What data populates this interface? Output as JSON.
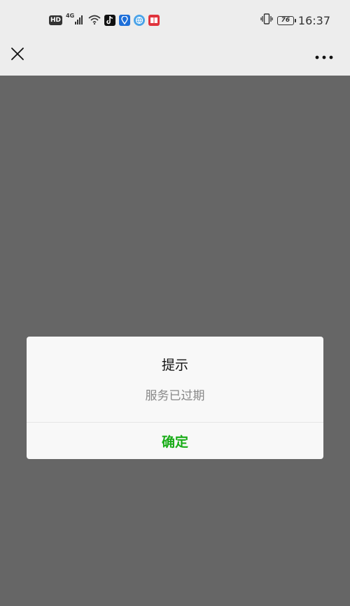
{
  "status_bar": {
    "hd_label": "HD",
    "network_type": "4G",
    "battery_level": "76",
    "time": "16:37",
    "icons": [
      "hd-badge",
      "signal-icon",
      "wifi-icon",
      "tiktok-icon",
      "location-app-icon",
      "globe-app-icon",
      "book-app-icon",
      "vibrate-icon",
      "battery-icon"
    ]
  },
  "nav": {
    "close_icon": "close-icon",
    "more_icon": "more-icon"
  },
  "dialog": {
    "title": "提示",
    "message": "服务已过期",
    "confirm_label": "确定",
    "confirm_color": "#1aad19"
  },
  "colors": {
    "overlay": "#666666",
    "bar_background": "#ededed",
    "dialog_background": "#f8f8f8"
  }
}
